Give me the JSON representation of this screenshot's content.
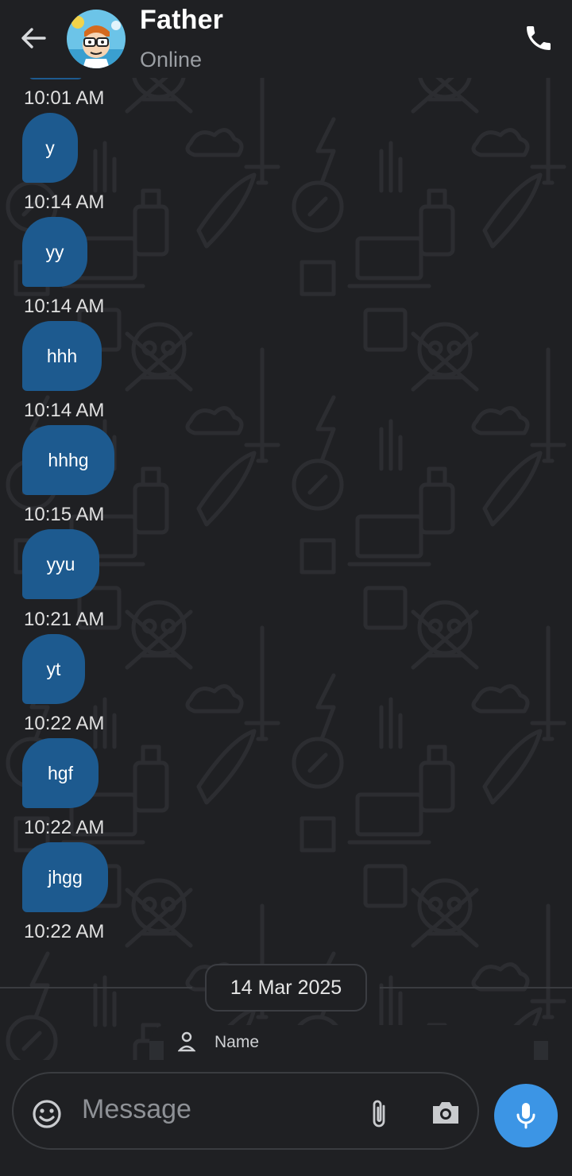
{
  "header": {
    "title": "Father",
    "status": "Online",
    "back_icon": "arrow-left-icon",
    "call_icon": "phone-icon",
    "avatar": "contact-avatar"
  },
  "messages": [
    {
      "text": "y",
      "time": "10:01 AM"
    },
    {
      "text": "yy",
      "time": "10:14 AM"
    },
    {
      "text": "hhh",
      "time": "10:14 AM"
    },
    {
      "text": "hhhg",
      "time": "10:14 AM"
    },
    {
      "text": "yyu",
      "time": "10:15 AM"
    },
    {
      "text": "yt",
      "time": "10:21 AM"
    },
    {
      "text": "hgf",
      "time": "10:22 AM"
    },
    {
      "text": "jhgg",
      "time": "10:22 AM"
    },
    {
      "text": "",
      "time": "10:22 AM"
    }
  ],
  "date_chip": "14 Mar 2025",
  "card": {
    "label": "Name"
  },
  "composer": {
    "placeholder": "Message",
    "emoji_icon": "emoji-icon",
    "attach_icon": "paperclip-icon",
    "camera_icon": "camera-icon",
    "mic_icon": "microphone-icon"
  },
  "colors": {
    "background": "#1f2023",
    "bubble": "#1d5a8f",
    "accent": "#3c95e5",
    "secondary_text": "#9a9ea3"
  }
}
